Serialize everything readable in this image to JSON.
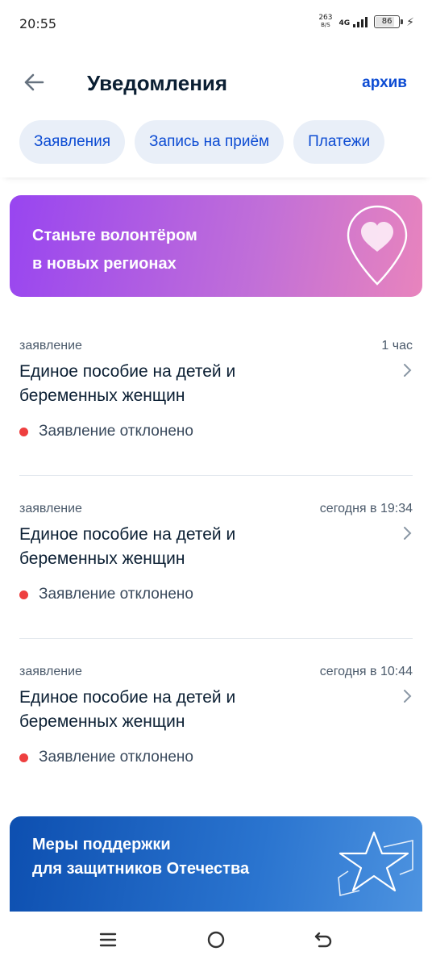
{
  "status_bar": {
    "time": "20:55",
    "net_speed_value": "263",
    "net_speed_unit": "B/S",
    "network": "4G",
    "battery": "86"
  },
  "header": {
    "title": "Уведомления",
    "archive_label": "архив"
  },
  "tabs": [
    "Заявления",
    "Запись на приём",
    "Платежи"
  ],
  "banner_volunteer": {
    "line1": "Станьте волонтёром",
    "line2": "в новых регионах"
  },
  "notifications": [
    {
      "type": "заявление",
      "time": "1 час",
      "title_line1": "Единое пособие на детей и",
      "title_line2": "беременных женщин",
      "status": "Заявление отклонено"
    },
    {
      "type": "заявление",
      "time": "сегодня в 19:34",
      "title_line1": "Единое пособие на детей и",
      "title_line2": "беременных женщин",
      "status": "Заявление отклонено"
    },
    {
      "type": "заявление",
      "time": "сегодня в 10:44",
      "title_line1": "Единое пособие на детей и",
      "title_line2": "беременных женщин",
      "status": "Заявление отклонено"
    }
  ],
  "banner_support": {
    "line1": "Меры поддержки",
    "line2": "для защитников Отечества"
  },
  "colors": {
    "accent": "#0d4cd3",
    "status_rejected": "#ee3f3f",
    "chip_bg": "#e9eff8"
  },
  "icons": {
    "back": "arrow-left-icon",
    "chevron": "chevron-right-icon",
    "pin": "heart-pin-icon",
    "star": "star-icon",
    "nav_menu": "menu-icon",
    "nav_home": "home-circle-icon",
    "nav_back": "back-arrow-icon"
  }
}
